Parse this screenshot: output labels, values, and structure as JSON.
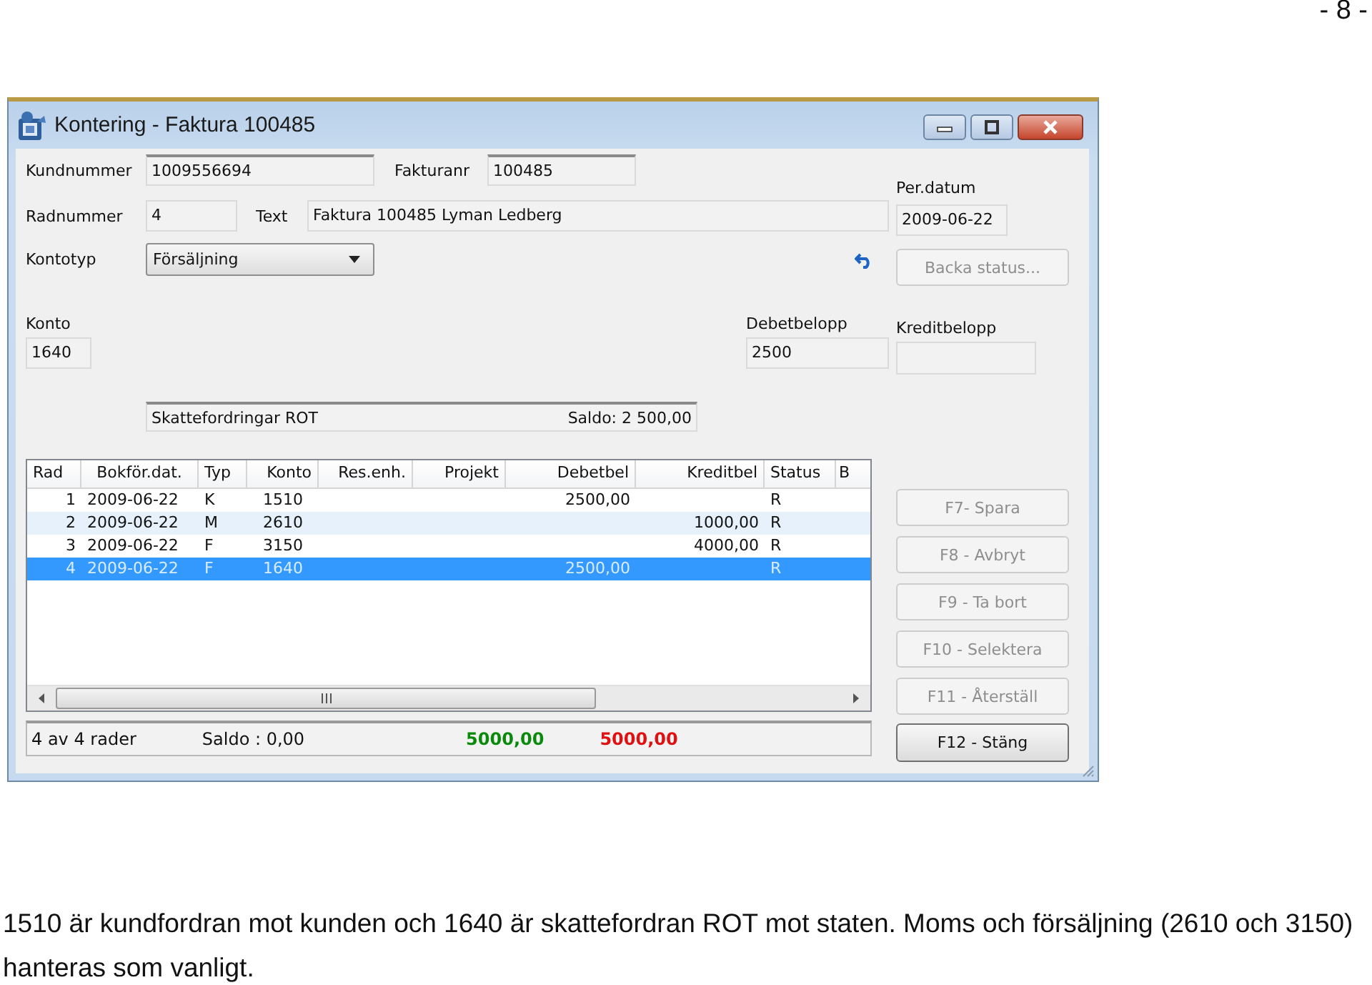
{
  "page_number": "- 8 -",
  "window": {
    "title": "Kontering - Faktura 100485"
  },
  "form": {
    "kundnummer": {
      "label": "Kundnummer",
      "value": "1009556694"
    },
    "fakturanr": {
      "label": "Fakturanr",
      "value": "100485"
    },
    "radnummer": {
      "label": "Radnummer",
      "value": "4"
    },
    "text": {
      "label": "Text",
      "value": "Faktura 100485 Lyman Ledberg"
    },
    "kontotyp": {
      "label": "Kontotyp",
      "value": "Försäljning"
    },
    "per_datum": {
      "label": "Per.datum",
      "value": "2009-06-22"
    },
    "backa_status": {
      "label": "Backa status...",
      "disabled": true
    },
    "konto": {
      "label": "Konto",
      "value": "1640"
    },
    "debetbelopp": {
      "label": "Debetbelopp",
      "value": "2500"
    },
    "kreditbelopp": {
      "label": "Kreditbelopp"
    },
    "account": {
      "name": "Skattefordringar ROT",
      "saldo": "Saldo: 2 500,00"
    }
  },
  "table": {
    "columns": [
      "Rad",
      "Bokför.dat.",
      "Typ",
      "Konto",
      "Res.enh.",
      "Projekt",
      "Debetbel",
      "Kreditbel",
      "Status",
      "B"
    ],
    "rows": [
      {
        "rad": "1",
        "date": "2009-06-22",
        "typ": "K",
        "konto": "1510",
        "debet": "2500,00",
        "status": "R",
        "selected": false
      },
      {
        "rad": "2",
        "date": "2009-06-22",
        "typ": "M",
        "konto": "2610",
        "kredit": "1000,00",
        "status": "R",
        "selected": false
      },
      {
        "rad": "3",
        "date": "2009-06-22",
        "typ": "F",
        "konto": "3150",
        "kredit": "4000,00",
        "status": "R",
        "selected": false
      },
      {
        "rad": "4",
        "date": "2009-06-22",
        "typ": "F",
        "konto": "1640",
        "debet": "2500,00",
        "status": "R",
        "selected": true
      }
    ]
  },
  "status_bar": {
    "row_count": "4 av 4 rader",
    "saldo": "Saldo : 0,00",
    "totals": [
      {
        "text": "5000,00",
        "color": "#0a8a0a"
      },
      {
        "text": "5000,00",
        "color": "#e01010"
      }
    ]
  },
  "buttons": [
    {
      "label": "F7- Spara",
      "disabled": true
    },
    {
      "label": "F8 - Avbryt",
      "disabled": true
    },
    {
      "label": "F9 - Ta bort",
      "disabled": true
    },
    {
      "label": "F10 - Selektera",
      "disabled": true
    },
    {
      "label": "F11 - Återställ",
      "disabled": true
    },
    {
      "label": "F12 - Stäng",
      "disabled": false
    }
  ],
  "caption": "1510 är kundfordran mot kunden och 1640 är skattefordran ROT mot staten. Moms och försäljning (2610 och 3150) hanteras som vanligt."
}
